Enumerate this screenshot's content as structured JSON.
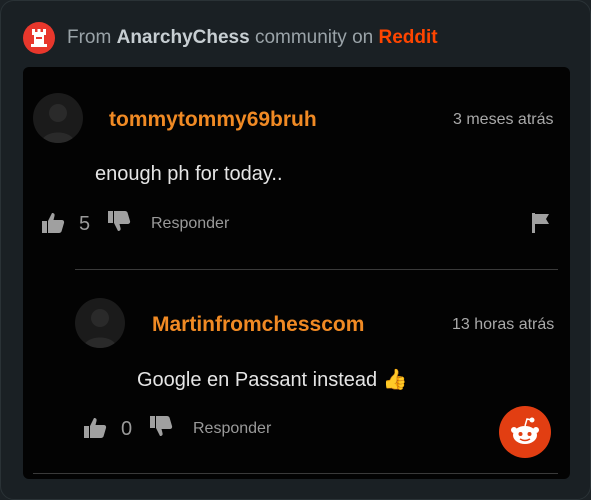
{
  "header": {
    "prefix": "From",
    "community": "AnarchyChess",
    "middle": "community on",
    "platform": "Reddit"
  },
  "colors": {
    "accent_orange": "#f08a24",
    "reddit_red": "#ff4500",
    "panel_bg": "#030303",
    "card_bg": "#1a2024"
  },
  "comments": [
    {
      "username": "tommytommy69bruh",
      "time": "3 meses atrás",
      "text": "enough ph for today..",
      "likes": "5",
      "reply_label": "Responder",
      "icons": [
        "thumbs-up-icon",
        "thumbs-down-icon",
        "flag-icon"
      ]
    },
    {
      "username": "Martinfromchesscom",
      "time": "13 horas atrás",
      "text": "Google en Passant instead",
      "emoji": "👍",
      "likes": "0",
      "reply_label": "Responder",
      "icons": [
        "thumbs-up-icon",
        "thumbs-down-icon"
      ]
    }
  ]
}
